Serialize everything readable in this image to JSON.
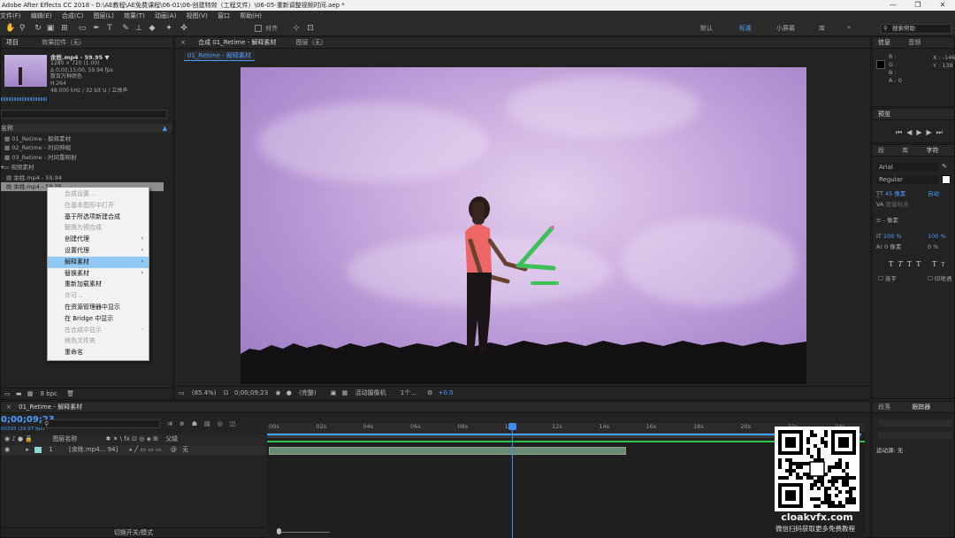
{
  "window": {
    "title": "Adobe After Effects CC 2018 - D:\\AE教程\\AE免费课程\\06-01\\06-创建特效（工程文件）\\06-05-重新调整视频时间.aep *",
    "controls": [
      "—",
      "❐",
      "✕"
    ]
  },
  "menu": [
    "文件(F)",
    "编辑(E)",
    "合成(C)",
    "图层(L)",
    "效果(T)",
    "动画(A)",
    "视图(V)",
    "窗口",
    "帮助(H)"
  ],
  "toolbar": {
    "snap_label": "对齐",
    "workspaces": [
      "默认",
      "标准",
      "小屏幕",
      "库"
    ],
    "active_workspace": "标准",
    "search_placeholder": "搜索帮助"
  },
  "project": {
    "tab_project": "项目",
    "tab_effects": "效果控件（无）",
    "footage_name": "余姓.mp4 - 59.95 ▼",
    "footage_res": "1280 × 720 (1.00)",
    "footage_dur": "Δ 0;00;15;00, 59.94 fps",
    "footage_colors": "数百万种颜色",
    "footage_codec": "H.264",
    "footage_audio": "48.000 kHz / 32 bit U / 立体声",
    "search_placeholder": "",
    "col_name": "名称",
    "items": [
      "01_Retime - 解释素材",
      "02_Retime - 时间伸缩",
      "03_Retime - 时间重映射",
      "视频素材",
      "余姓.mp4 - 59.94",
      "余姓.mp4 - 59.95"
    ],
    "bpc": "8 bpc"
  },
  "context_menu": [
    {
      "label": "合成设置...",
      "disabled": true,
      "sub": false
    },
    {
      "label": "在基本图形中打开",
      "disabled": true,
      "sub": false
    },
    {
      "label": "基于所选项新建合成",
      "disabled": false,
      "sub": false
    },
    {
      "label": "替换为预合成",
      "disabled": true,
      "sub": false
    },
    {
      "label": "创建代理",
      "disabled": false,
      "sub": true
    },
    {
      "label": "设置代理",
      "disabled": false,
      "sub": true
    },
    {
      "label": "解释素材",
      "disabled": false,
      "sub": true,
      "highlight": true
    },
    {
      "label": "替换素材",
      "disabled": false,
      "sub": true
    },
    {
      "label": "重新加载素材",
      "disabled": false,
      "sub": false
    },
    {
      "label": "许可...",
      "disabled": true,
      "sub": false
    },
    {
      "label": "在资源管理器中显示",
      "disabled": false,
      "sub": false
    },
    {
      "label": "在 Bridge 中显示",
      "disabled": false,
      "sub": false
    },
    {
      "label": "在合成中显示",
      "disabled": true,
      "sub": true
    },
    {
      "label": "纯色文件夹",
      "disabled": true,
      "sub": false
    },
    {
      "label": "重命名",
      "disabled": false,
      "sub": false
    }
  ],
  "viewer": {
    "tab_comp": "合成 01_Retime - 解释素材",
    "tab_layer": "图层（无）",
    "breadcrumb": "01_Retime - 解释素材",
    "zoom": "(85.4%)",
    "timecode": "0;00;09;23",
    "quality": "(完整)",
    "camera": "活动摄像机",
    "views": "1个...",
    "exposure": "+0.0"
  },
  "info_panel": {
    "tab_info": "信息",
    "tab_audio": "音频",
    "r": "R :",
    "g": "G :",
    "b": "B :",
    "a": "A : 0",
    "x": "X : -146",
    "y": "Y : 138"
  },
  "preview_panel": {
    "title": "预览"
  },
  "character_panel": {
    "tabs": [
      "段",
      "库",
      "字符"
    ],
    "font": "Arial",
    "style": "Regular",
    "size": "45 像素",
    "leading": "自动",
    "tracking": "度量标准",
    "stroke": "- 像素",
    "vscale": "100 %",
    "hscale": "100 %",
    "baseline": "0 像素",
    "tsume": "0 %",
    "ligature": "连字",
    "hindi": "印地语"
  },
  "timeline": {
    "comp_name": "01_Retime - 解释素材",
    "timecode": "0;00;09;23",
    "fps_info": "00293 (29.97 fps)",
    "col_layer": "图层名称",
    "col_parent": "父级",
    "layer_num": "1",
    "layer_name": "[余姓.mp4... 94]",
    "parent_val": "无",
    "ruler": [
      "00s",
      "02s",
      "04s",
      "06s",
      "08s",
      "10s",
      "12s",
      "14s",
      "16s",
      "18s",
      "20s",
      "22s",
      "24s"
    ],
    "bottom_label": "切换开关/模式",
    "playhead_fraction": 0.41,
    "bar_end_fraction": 0.6
  },
  "tracker_panel": {
    "tabs": [
      "段落",
      "跟踪器"
    ],
    "motion_source_label": "运动源:",
    "motion_source_val": "无"
  },
  "watermark": {
    "site": "cloakvfx.com",
    "caption": "微信扫码获取更多免费教程"
  }
}
